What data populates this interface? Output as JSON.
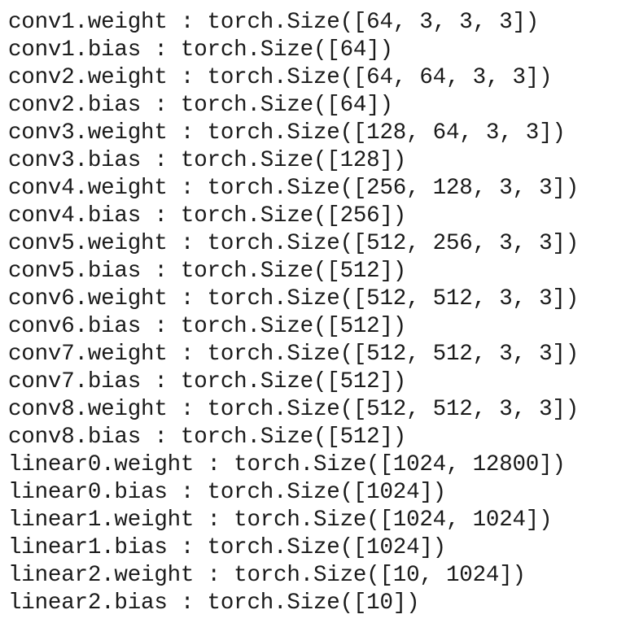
{
  "output": {
    "lines": [
      "conv1.weight : torch.Size([64, 3, 3, 3])",
      "conv1.bias : torch.Size([64])",
      "conv2.weight : torch.Size([64, 64, 3, 3])",
      "conv2.bias : torch.Size([64])",
      "conv3.weight : torch.Size([128, 64, 3, 3])",
      "conv3.bias : torch.Size([128])",
      "conv4.weight : torch.Size([256, 128, 3, 3])",
      "conv4.bias : torch.Size([256])",
      "conv5.weight : torch.Size([512, 256, 3, 3])",
      "conv5.bias : torch.Size([512])",
      "conv6.weight : torch.Size([512, 512, 3, 3])",
      "conv6.bias : torch.Size([512])",
      "conv7.weight : torch.Size([512, 512, 3, 3])",
      "conv7.bias : torch.Size([512])",
      "conv8.weight : torch.Size([512, 512, 3, 3])",
      "conv8.bias : torch.Size([512])",
      "linear0.weight : torch.Size([1024, 12800])",
      "linear0.bias : torch.Size([1024])",
      "linear1.weight : torch.Size([1024, 1024])",
      "linear1.bias : torch.Size([1024])",
      "linear2.weight : torch.Size([10, 1024])",
      "linear2.bias : torch.Size([10])"
    ]
  }
}
